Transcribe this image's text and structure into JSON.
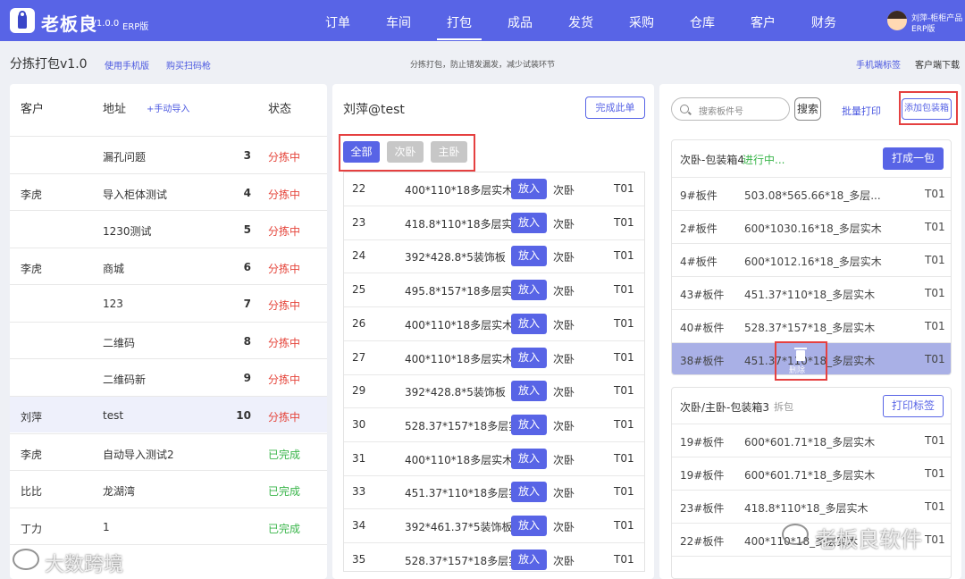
{
  "app": {
    "brand": "老板良",
    "version": "V1.0.0",
    "edition": "ERP版"
  },
  "nav": {
    "items": [
      "订单",
      "车间",
      "打包",
      "成品",
      "发货",
      "采购",
      "仓库",
      "客户",
      "财务"
    ],
    "active": "打包"
  },
  "user": {
    "line1": "刘萍-柜柜产品",
    "line2": "ERP版"
  },
  "subheader": {
    "title": "分拣打包v1.0",
    "links": [
      "使用手机版",
      "购买扫码枪"
    ],
    "note": "分拣打包，防止错发漏发，减少试装环节",
    "right_links": [
      "手机端标签",
      "客户端下载"
    ]
  },
  "left": {
    "headers": {
      "customer": "客户",
      "address": "地址",
      "import": "+手动导入",
      "status": "状态"
    },
    "rows": [
      {
        "customer": "",
        "address": "漏孔问题",
        "num": "3",
        "status": "分拣中"
      },
      {
        "customer": "李虎",
        "address": "导入柜体测试",
        "num": "4",
        "status": "分拣中"
      },
      {
        "customer": "",
        "address": "1230测试",
        "num": "5",
        "status": "分拣中"
      },
      {
        "customer": "李虎",
        "address": "商城",
        "num": "6",
        "status": "分拣中"
      },
      {
        "customer": "",
        "address": "123",
        "num": "7",
        "status": "分拣中"
      },
      {
        "customer": "",
        "address": "二维码",
        "num": "8",
        "status": "分拣中"
      },
      {
        "customer": "",
        "address": "二维码新",
        "num": "9",
        "status": "分拣中"
      },
      {
        "customer": "刘萍",
        "address": "test",
        "num": "10",
        "status": "分拣中"
      },
      {
        "customer": "李虎",
        "address": "自动导入测试2",
        "num": "",
        "status": "已完成"
      },
      {
        "customer": "比比",
        "address": "龙湖湾",
        "num": "",
        "status": "已完成"
      },
      {
        "customer": "丁力",
        "address": "1",
        "num": "",
        "status": "已完成"
      }
    ]
  },
  "middle": {
    "title": "刘萍@test",
    "complete_btn": "完成此单",
    "filters": [
      "全部",
      "次卧",
      "主卧"
    ],
    "put_label": "放入",
    "rows": [
      {
        "id": "22",
        "spec": "400*110*18多层实木",
        "room": "次卧",
        "tag": "T01"
      },
      {
        "id": "23",
        "spec": "418.8*110*18多层实木",
        "room": "次卧",
        "tag": "T01"
      },
      {
        "id": "24",
        "spec": "392*428.8*5装饰板",
        "room": "次卧",
        "tag": "T01"
      },
      {
        "id": "25",
        "spec": "495.8*157*18多层实木",
        "room": "次卧",
        "tag": "T01"
      },
      {
        "id": "26",
        "spec": "400*110*18多层实木",
        "room": "次卧",
        "tag": "T01"
      },
      {
        "id": "27",
        "spec": "400*110*18多层实木",
        "room": "次卧",
        "tag": "T01"
      },
      {
        "id": "29",
        "spec": "392*428.8*5装饰板",
        "room": "次卧",
        "tag": "T01"
      },
      {
        "id": "30",
        "spec": "528.37*157*18多层实木",
        "room": "次卧",
        "tag": "T01"
      },
      {
        "id": "31",
        "spec": "400*110*18多层实木",
        "room": "次卧",
        "tag": "T01"
      },
      {
        "id": "33",
        "spec": "451.37*110*18多层实木",
        "room": "次卧",
        "tag": "T01"
      },
      {
        "id": "34",
        "spec": "392*461.37*5装饰板",
        "room": "次卧",
        "tag": "T01"
      },
      {
        "id": "35",
        "spec": "528.37*157*18多层实木",
        "room": "次卧",
        "tag": "T01"
      }
    ]
  },
  "right": {
    "search_placeholder": "搜索板件号",
    "search_btn": "搜索",
    "batch_print": "批量打印",
    "add_box": "添加包装箱",
    "box1": {
      "title": "次卧-包装箱4",
      "status": "进行中...",
      "btn": "打成一包",
      "rows": [
        {
          "id": "9#板件",
          "spec": "503.08*565.66*18_多层...",
          "tag": "T01"
        },
        {
          "id": "2#板件",
          "spec": "600*1030.16*18_多层实木",
          "tag": "T01"
        },
        {
          "id": "4#板件",
          "spec": "600*1012.16*18_多层实木",
          "tag": "T01"
        },
        {
          "id": "43#板件",
          "spec": "451.37*110*18_多层实木",
          "tag": "T01"
        },
        {
          "id": "40#板件",
          "spec": "528.37*157*18_多层实木",
          "tag": "T01"
        },
        {
          "id": "38#板件",
          "spec": "451.37*110*18_多层实木",
          "tag": "T01"
        }
      ],
      "delete_label": "删除"
    },
    "box2": {
      "title": "次卧/主卧-包装箱3",
      "sub": "拆包",
      "btn": "打印标签",
      "rows": [
        {
          "id": "19#板件",
          "spec": "600*601.71*18_多层实木",
          "tag": "T01"
        },
        {
          "id": "19#板件",
          "spec": "600*601.71*18_多层实木",
          "tag": "T01"
        },
        {
          "id": "23#板件",
          "spec": "418.8*110*18_多层实木",
          "tag": "T01"
        },
        {
          "id": "22#板件",
          "spec": "400*110*18_多层实木",
          "tag": "T01"
        }
      ]
    }
  },
  "watermarks": {
    "left": "大数跨境",
    "right": "老板良软件"
  },
  "colors": {
    "primary": "#5864e6",
    "sorting": "#e5453b",
    "done": "#39b54a",
    "highlight": "#e54040"
  }
}
